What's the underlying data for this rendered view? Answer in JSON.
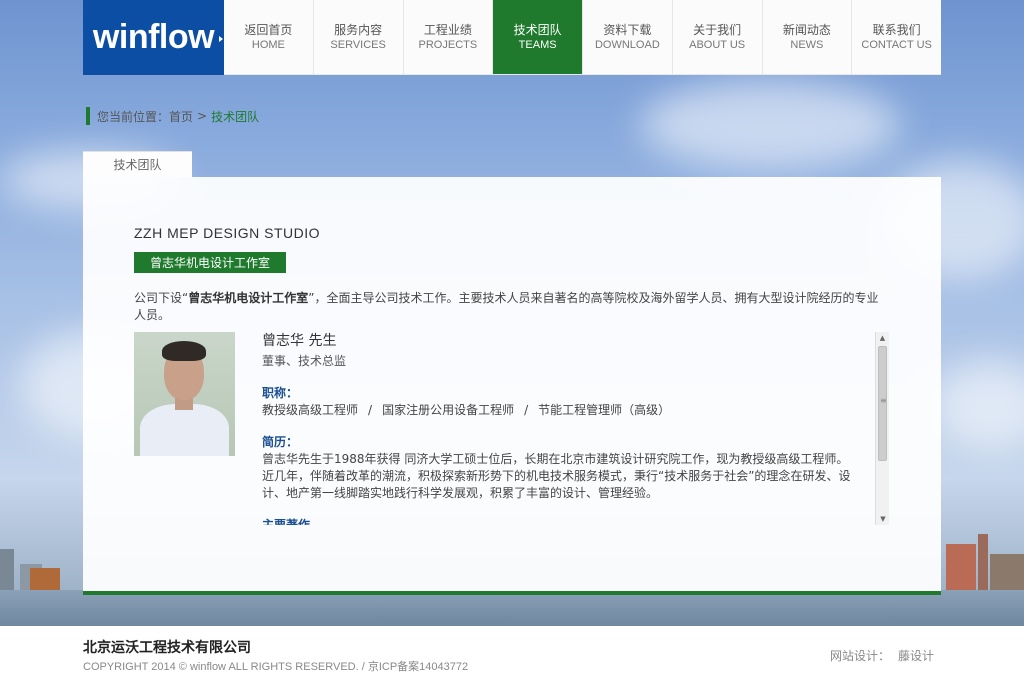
{
  "brand": {
    "logo_text": "winflow"
  },
  "nav": [
    {
      "cn": "返回首页",
      "en": "HOME"
    },
    {
      "cn": "服务内容",
      "en": "SERVICES"
    },
    {
      "cn": "工程业绩",
      "en": "PROJECTS"
    },
    {
      "cn": "技术团队",
      "en": "TEAMS",
      "active": true
    },
    {
      "cn": "资料下载",
      "en": "DOWNLOAD"
    },
    {
      "cn": "关于我们",
      "en": "ABOUT US"
    },
    {
      "cn": "新闻动态",
      "en": "NEWS"
    },
    {
      "cn": "联系我们",
      "en": "CONTACT US"
    }
  ],
  "breadcrumb": {
    "prefix": "您当前位置：",
    "home": "首页",
    "sep": ">",
    "current": "技术团队"
  },
  "tab": {
    "label": "技术团队"
  },
  "studio": {
    "title": "ZZH MEP DESIGN STUDIO",
    "badge": "曾志华机电设计工作室",
    "intro_before": "公司下设“",
    "intro_bold": "曾志华机电设计工作室",
    "intro_after": "”，全面主导公司技术工作。主要技术人员来自著名的高等院校及海外留学人员、拥有大型设计院经历的专业人员。"
  },
  "person": {
    "name": "曾志华 先生",
    "role": "董事、技术总监",
    "titles_heading": "职称：",
    "titles": [
      "教授级高级工程师",
      "国家注册公用设备工程师",
      "节能工程管理师（高级）"
    ],
    "title_sep": "/",
    "resume_heading": "简历：",
    "resume_line1": "曾志华先生于1988年获得 同济大学工硕士位后，长期在北京市建筑设计研究院工作，现为教授级高级工程师。",
    "resume_line2": "近几年，伴随着改革的潮流，积极探索新形势下的机电技术服务模式，秉行“技术服务于社会”的理念在研发、设计、地产第一线脚踏实地践行科学发展观，积累了丰富的设计、管理经验。",
    "next_heading": "主要著作"
  },
  "footer": {
    "company": "北京运沃工程技术有限公司",
    "copyright": "COPYRIGHT 2014 © winflow ALL RIGHTS RESERVED. / 京ICP备案14043772",
    "credit_label": "网站设计：",
    "credit_name": "藤设计"
  },
  "colors": {
    "brand_blue": "#0c4ea3",
    "accent_green": "#1f7a2d",
    "heading_blue": "#1b4f92"
  }
}
